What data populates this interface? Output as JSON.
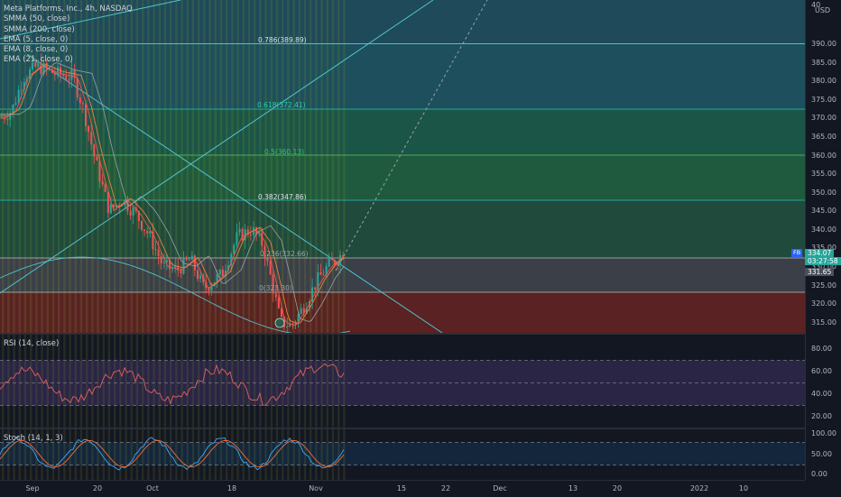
{
  "legend": {
    "title": "Meta Platforms, Inc., 4h, NASDAQ",
    "indicators": [
      "SMMA (50, close)",
      "SMMA (200, close)",
      "EMA (5, close, 0)",
      "EMA (8, close, 0)",
      "EMA (21, close, 0)"
    ]
  },
  "rsi_label": "RSI (14, close)",
  "stoch_label": "Stoch (14, 1, 3)",
  "price_axis": {
    "currency": "USD",
    "ticks": [
      "390.00",
      "385.00",
      "380.00",
      "375.00",
      "370.00",
      "365.00",
      "360.00",
      "355.00",
      "350.00",
      "345.00",
      "340.00",
      "335.00",
      "330.00",
      "325.00",
      "320.00",
      "315.00"
    ],
    "top_partial": "40"
  },
  "rsi_axis": [
    "80.00",
    "60.00",
    "40.00",
    "20.00"
  ],
  "stoch_axis": [
    "100.00",
    "50.00",
    "0.00"
  ],
  "time_axis": [
    "Sep",
    "20",
    "Oct",
    "18",
    "Nov",
    "15",
    "22",
    "Dec",
    "13",
    "20",
    "2022",
    "10"
  ],
  "fib_labels": [
    "0.786(389.89)",
    "0.618(372.41)",
    "0.5(360.13)",
    "0.382(347.86)",
    "0.236(332.66)",
    "0(323.30)"
  ],
  "price_badges": {
    "symbol": "FB",
    "last": "334.07",
    "countdown": "03:27:58",
    "other": "331.65"
  },
  "colors": {
    "up": "#26a69a",
    "down": "#ef5350",
    "fib": "#22ab94",
    "accent": "#2962ff"
  }
}
